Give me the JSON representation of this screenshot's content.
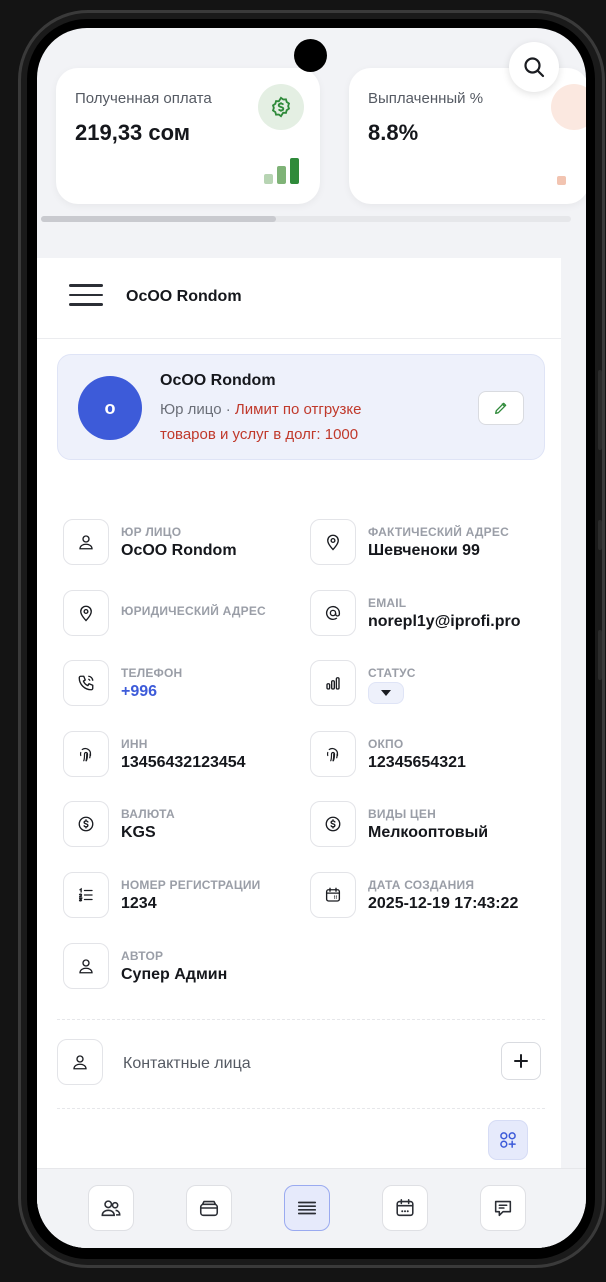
{
  "stats": [
    {
      "label": "Полученная оплата",
      "value": "219,33 сом",
      "icon": "dollar-badge-icon",
      "accent": "#2f8a3a"
    },
    {
      "label": "Выплаченный %",
      "value": "8.8%",
      "icon": "percent-badge-icon",
      "accent": "#e8a48a"
    }
  ],
  "header": {
    "title": "OcOO Rondom"
  },
  "profile": {
    "initial": "о",
    "name": "OcOO Rondom",
    "type": "Юр лицо",
    "separator": " · ",
    "limit": "Лимит по отгрузке товаров и услуг в долг: 1000"
  },
  "fields": {
    "legal_entity": {
      "label": "Юр лицо",
      "value": "OcOO Rondom"
    },
    "actual_address": {
      "label": "Фактический адрес",
      "value": "Шевченоки 99"
    },
    "legal_address": {
      "label": "Юридический адрес",
      "value": ""
    },
    "email": {
      "label": "Email",
      "value": "norepl1y@iprofi.pro"
    },
    "phone": {
      "label": "Телефон",
      "value": "+996"
    },
    "status": {
      "label": "Статус",
      "value": ""
    },
    "inn": {
      "label": "ИНН",
      "value": "13456432123454"
    },
    "okpo": {
      "label": "ОКПО",
      "value": "12345654321"
    },
    "currency": {
      "label": "Валюта",
      "value": "KGS"
    },
    "price_types": {
      "label": "Виды цен",
      "value": "Мелкооптовый"
    },
    "registration_number": {
      "label": "Номер регистрации",
      "value": "1234"
    },
    "created_date": {
      "label": "Дата создания",
      "value": "2025-12-19 17:43:22"
    },
    "author": {
      "label": "Автор",
      "value": "Супер Админ"
    }
  },
  "contacts": {
    "label": "Контактные лица"
  },
  "colors": {
    "primary": "#3d5bd9",
    "danger": "#c0392b",
    "success": "#2f8a3a"
  },
  "nav": [
    "users-icon",
    "wallet-icon",
    "list-icon",
    "calendar-icon",
    "chat-icon"
  ]
}
